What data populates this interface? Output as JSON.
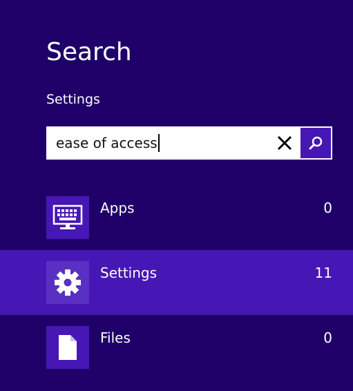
{
  "charm": {
    "title": "Search",
    "scope": "Settings"
  },
  "search": {
    "query": "ease of access",
    "clear_icon": "close-icon",
    "go_icon": "search-icon"
  },
  "results": [
    {
      "label": "Apps",
      "count": "0",
      "icon": "keyboard-icon",
      "selected": false
    },
    {
      "label": "Settings",
      "count": "11",
      "icon": "gear-icon",
      "selected": true
    },
    {
      "label": "Files",
      "count": "0",
      "icon": "document-icon",
      "selected": false
    }
  ],
  "colors": {
    "background": "#1f0068",
    "accent": "#4617b4",
    "selected_row": "#4617b4",
    "searchbox": "#ffffff"
  }
}
